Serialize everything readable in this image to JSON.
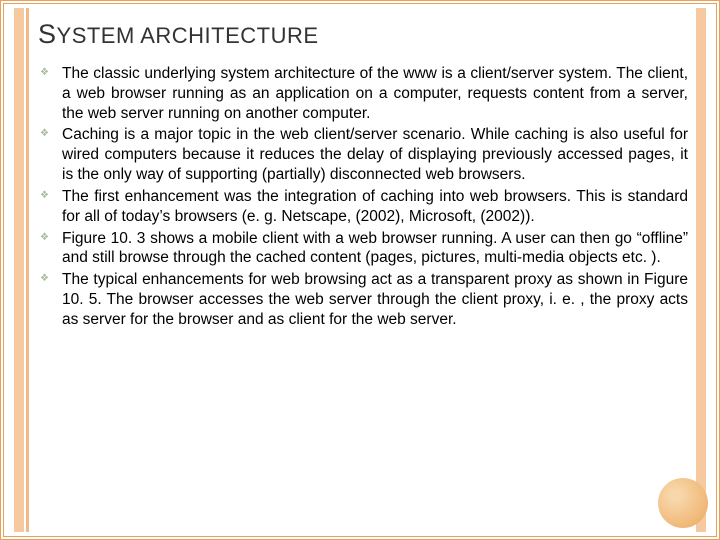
{
  "title": {
    "word1_first": "S",
    "word1_rest": "YSTEM",
    "space": " ",
    "word2": "ARCHITECTURE"
  },
  "bullets": [
    "The classic underlying system architecture of the www is a client/server system. The client, a web browser running as an application on a computer, requests content from a server, the web server running on another computer.",
    "Caching is a major topic in the web client/server scenario. While caching is also useful for wired computers because it reduces the delay of displaying previously accessed pages, it is the only way of supporting (partially) disconnected web browsers.",
    "The first enhancement was the integration of caching into web browsers. This is standard for all of today’s browsers (e. g. Netscape, (2002), Microsoft, (2002)).",
    "Figure 10. 3 shows a mobile client with a web browser running. A user can then go “offline” and still browse through the cached content (pages, pictures, multi-media objects etc. ).",
    "The typical enhancements for web browsing act as a transparent proxy as shown in Figure 10. 5. The browser accesses the web server through the client proxy, i. e. , the proxy acts as server for the browser and as client for the web server."
  ]
}
